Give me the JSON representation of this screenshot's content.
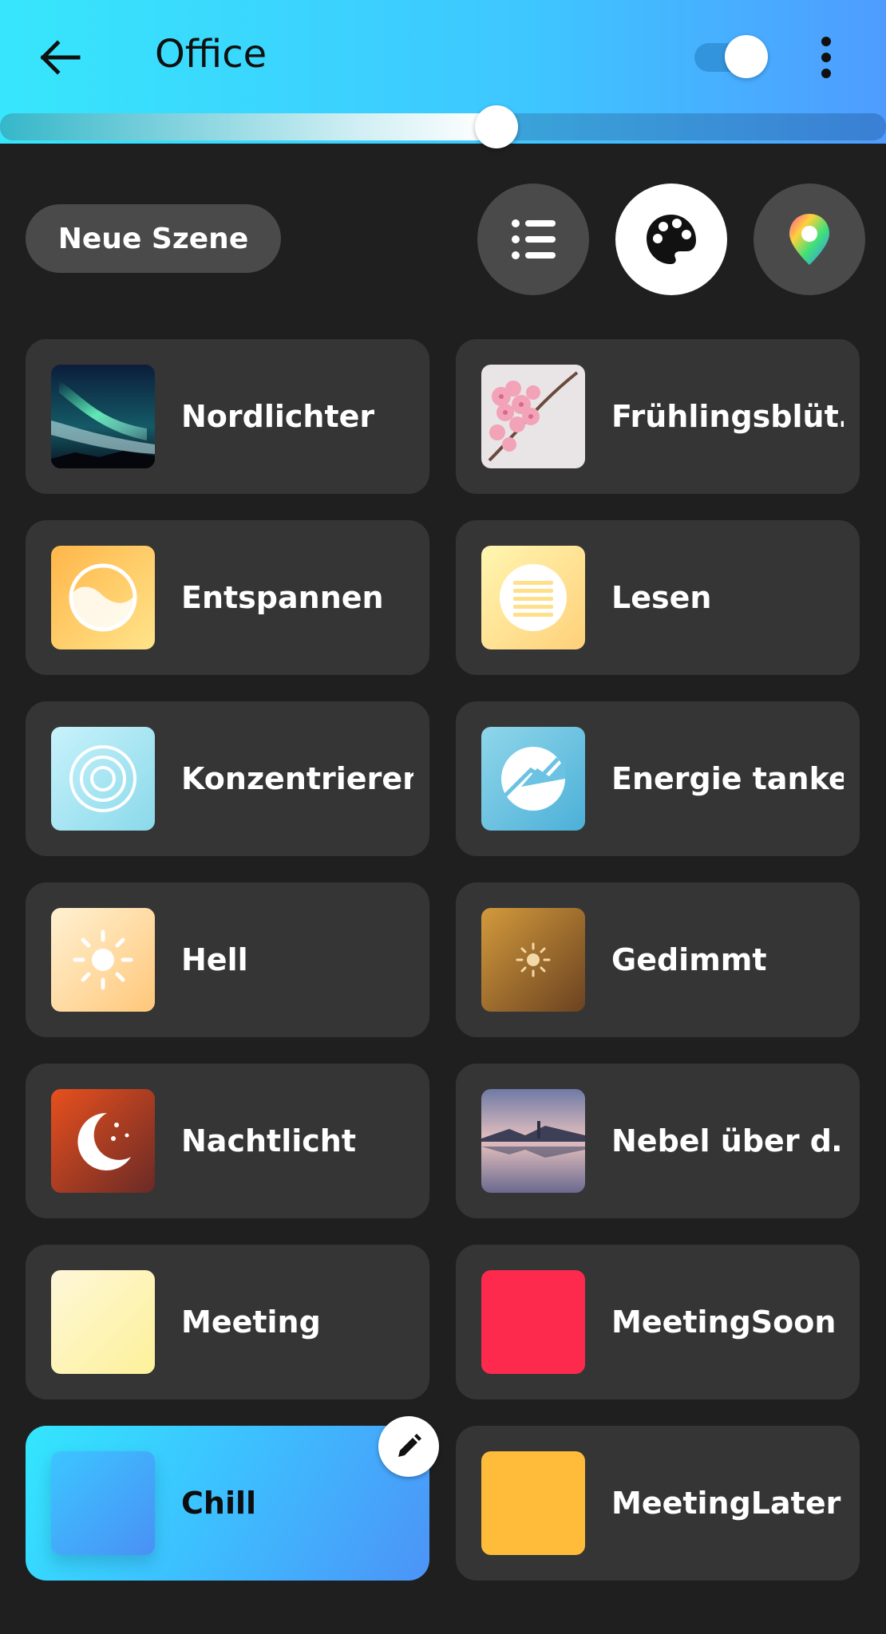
{
  "header": {
    "title": "Office",
    "power_on": true,
    "brightness_percent": 56
  },
  "toolbar": {
    "new_scene_label": "Neue Szene",
    "view_buttons": [
      {
        "icon": "list-icon",
        "active": false
      },
      {
        "icon": "palette-icon",
        "active": true
      },
      {
        "icon": "color-picker-icon",
        "active": false
      }
    ]
  },
  "scenes": [
    {
      "label": "Nordlichter",
      "thumb": "aurora-image"
    },
    {
      "label": "Frühlingsblüt…",
      "thumb": "blossom-image"
    },
    {
      "label": "Entspannen",
      "thumb": "relax-icon"
    },
    {
      "label": "Lesen",
      "thumb": "read-icon"
    },
    {
      "label": "Konzentrieren",
      "thumb": "concentrate-icon"
    },
    {
      "label": "Energie tanken",
      "thumb": "energize-icon"
    },
    {
      "label": "Hell",
      "thumb": "bright-icon"
    },
    {
      "label": "Gedimmt",
      "thumb": "dimmed-icon"
    },
    {
      "label": "Nachtlicht",
      "thumb": "nightlight-icon"
    },
    {
      "label": "Nebel über d…",
      "thumb": "fog-lake-image"
    },
    {
      "label": "Meeting",
      "thumb": "color-swatch",
      "color": "#fdf3b8"
    },
    {
      "label": "MeetingSoon",
      "thumb": "color-swatch",
      "color": "#fe2a4e"
    },
    {
      "label": "Chill",
      "thumb": "color-swatch",
      "color": "#4aa9ff",
      "active": true
    },
    {
      "label": "MeetingLater",
      "thumb": "color-swatch",
      "color": "#ffbb3a"
    }
  ]
}
